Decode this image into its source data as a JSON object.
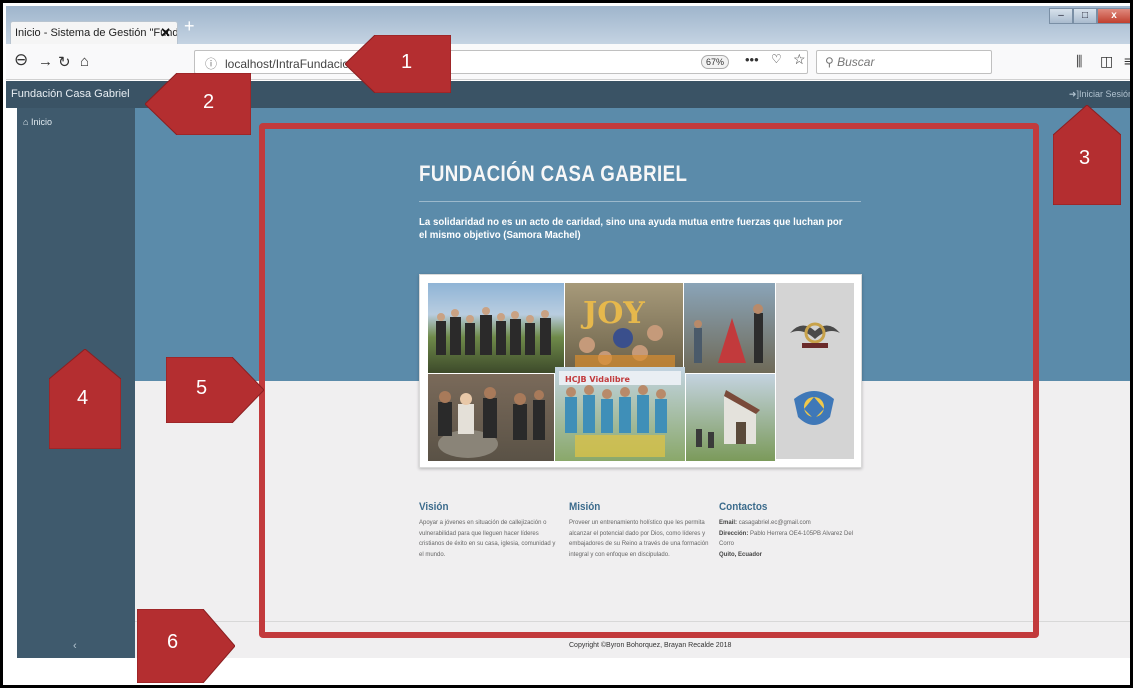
{
  "browser": {
    "tab_title": "Inicio - Sistema de Gestión \"Fundac",
    "tab_close": "✕",
    "new_tab": "+",
    "url": "localhost/IntraFundacion/",
    "zoom": "67%",
    "search_placeholder": "Buscar",
    "window_minimize": "–",
    "window_maximize": "□",
    "window_close": "x"
  },
  "app": {
    "brand": "Fundación Casa Gabriel",
    "login_label": "Iniciar Sesión",
    "sidebar": {
      "items": [
        {
          "label": "Inicio",
          "icon": "home-icon"
        }
      ],
      "collapse": "‹"
    },
    "hero": {
      "title": "FUNDACIÓN CASA GABRIEL",
      "quote": "La solidaridad no es un acto de caridad, sino una ayuda mutua entre fuerzas que luchan por el mismo objetivo (Samora Machel)"
    },
    "collage_labels": {
      "banner": "HCJB  Vidalibre",
      "joy": "JOY"
    },
    "columns": {
      "vision": {
        "title": "Visión",
        "text": "Apoyar a jóvenes en situación de callejización o vulnerabilidad para que lleguen hacer líderes cristianos de éxito en su casa, iglesia, comunidad y el mundo."
      },
      "mision": {
        "title": "Misión",
        "text": "Proveer un entrenamiento holístico que les permita alcanzar el potencial dado por Dios, como líderes y embajadores de su Reino a través de una formación integral y con enfoque en discipulado."
      },
      "contactos": {
        "title": "Contactos",
        "email_label": "Email:",
        "email": "casagabriel.ec@gmail.com",
        "address_label": "Dirección:",
        "address": "Pablo Herrera OE4-105PB Alvarez Del Corro",
        "city": "Quito, Ecuador"
      }
    },
    "footer": {
      "copyright": "Copyright ©Byron Bohorquez, Brayan Recalde 2018"
    }
  },
  "annotations": [
    "1",
    "2",
    "3",
    "4",
    "5",
    "6"
  ],
  "colors": {
    "header": "#3a5365",
    "sidebar": "#3f5a6d",
    "hero": "#5b8baa",
    "accent_title": "#3b6b8c",
    "annotation_red": "#c23a3c"
  }
}
